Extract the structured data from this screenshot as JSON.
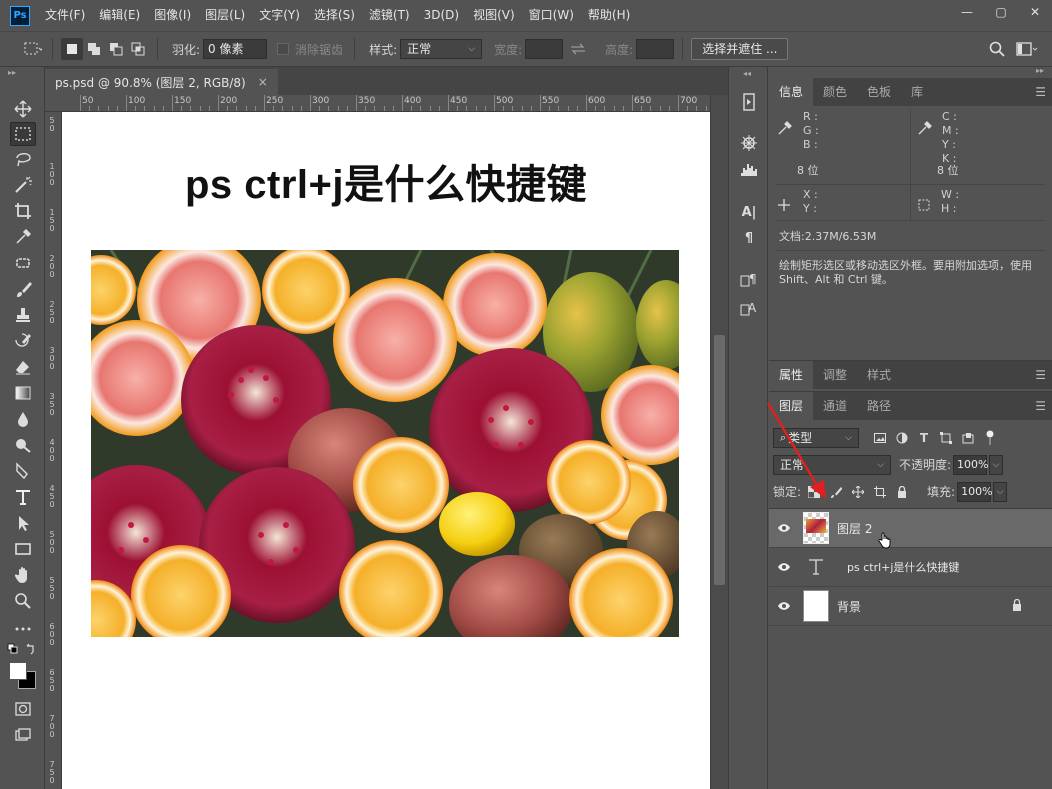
{
  "app": {
    "logo": "Ps"
  },
  "menu": [
    "文件(F)",
    "编辑(E)",
    "图像(I)",
    "图层(L)",
    "文字(Y)",
    "选择(S)",
    "滤镜(T)",
    "3D(D)",
    "视图(V)",
    "窗口(W)",
    "帮助(H)"
  ],
  "window_controls": {
    "minimize": "—",
    "restore": "▢",
    "close": "✕"
  },
  "options": {
    "feather_label": "羽化:",
    "feather_value": "0 像素",
    "antialias_label": "消除锯齿",
    "style_label": "样式:",
    "style_value": "正常",
    "width_label": "宽度:",
    "height_label": "高度:",
    "select_mask_button": "选择并遮住 ..."
  },
  "document": {
    "tab_label": "ps.psd @ 90.8% (图层 2, RGB/8)",
    "tab_close": "×",
    "title_text": "ps ctrl+j是什么快捷键"
  },
  "rulers": {
    "top": [
      "50",
      "100",
      "150",
      "200",
      "250",
      "300",
      "350",
      "400",
      "450",
      "500",
      "550",
      "600",
      "650",
      "700"
    ],
    "left": [
      "5 0",
      "1 0 0",
      "1 5 0",
      "2 0 0",
      "2 5 0",
      "3 0 0",
      "3 5 0",
      "4 0 0",
      "4 5 0",
      "5 0 0",
      "5 5 0",
      "6 0 0",
      "6 5 0",
      "7 0 0",
      "7 5 0"
    ]
  },
  "info_panel": {
    "tabs": [
      "信息",
      "颜色",
      "色板",
      "库"
    ],
    "rgb_labels": [
      "R :",
      "G :",
      "B :"
    ],
    "cmyk_labels": [
      "C :",
      "M :",
      "Y :",
      "K :"
    ],
    "bit_depth_left": "8 位",
    "bit_depth_right": "8 位",
    "xy_labels": [
      "X :",
      "Y :"
    ],
    "wh_labels": [
      "W :",
      "H :"
    ],
    "doc_size": "文档:2.37M/6.53M",
    "hint": "绘制矩形选区或移动选区外框。要用附加选项，使用 Shift、Alt 和 Ctrl 键。"
  },
  "properties_panel": {
    "tabs": [
      "属性",
      "调整",
      "样式"
    ]
  },
  "layers_panel": {
    "tabs": [
      "图层",
      "通道",
      "路径"
    ],
    "filter_kind": "类型",
    "blend_mode": "正常",
    "opacity_label": "不透明度:",
    "opacity_value": "100%",
    "lock_label": "锁定:",
    "fill_label": "填充:",
    "fill_value": "100%",
    "layers": [
      {
        "name": "图层 2",
        "type": "image",
        "selected": true
      },
      {
        "name": "ps ctrl+j是什么快捷键",
        "type": "text",
        "selected": false
      },
      {
        "name": "背景",
        "type": "background",
        "selected": false,
        "locked": true
      }
    ]
  },
  "colors": {
    "accent": "#31a8ff",
    "annotation_arrow": "#e02020",
    "panel_bg": "#535353"
  }
}
